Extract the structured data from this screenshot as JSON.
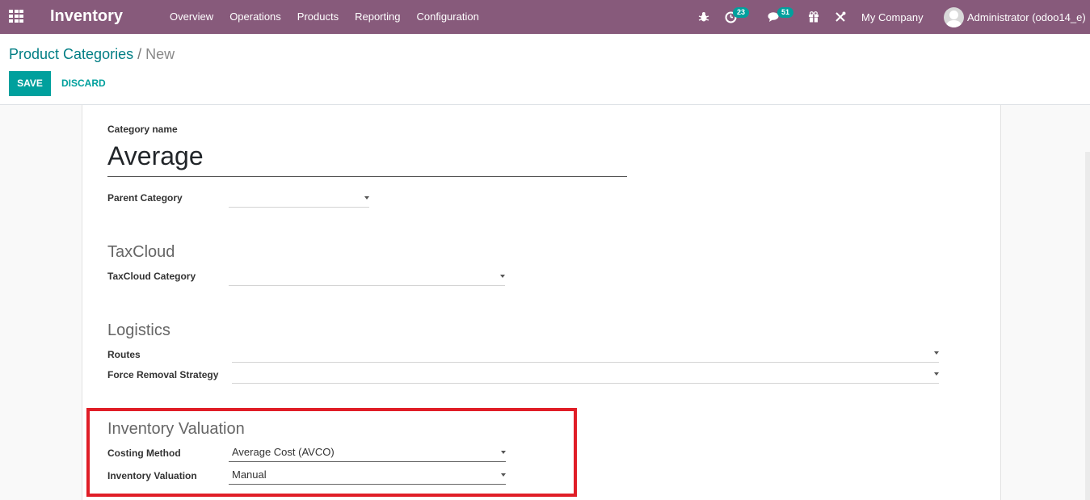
{
  "navbar": {
    "app_name": "Inventory",
    "menu": [
      "Overview",
      "Operations",
      "Products",
      "Reporting",
      "Configuration"
    ],
    "activity_count": "23",
    "messages_count": "51",
    "company": "My Company",
    "user": "Administrator (odoo14_e)",
    "bg_color": "#875a7b"
  },
  "breadcrumb": {
    "parent": "Product Categories",
    "separator": "/",
    "current": "New"
  },
  "actions": {
    "save": "SAVE",
    "discard": "DISCARD",
    "accent_color": "#00a09d"
  },
  "form": {
    "name_label": "Category name",
    "name_value": "Average",
    "parent_label": "Parent Category",
    "parent_value": "",
    "taxcloud": {
      "title": "TaxCloud",
      "category_label": "TaxCloud Category",
      "category_value": ""
    },
    "logistics": {
      "title": "Logistics",
      "routes_label": "Routes",
      "routes_value": "",
      "removal_label": "Force Removal Strategy",
      "removal_value": ""
    },
    "valuation": {
      "title": "Inventory Valuation",
      "costing_label": "Costing Method",
      "costing_value": "Average Cost (AVCO)",
      "valuation_label": "Inventory Valuation",
      "valuation_value": "Manual",
      "highlight_color": "#e01e27"
    }
  }
}
